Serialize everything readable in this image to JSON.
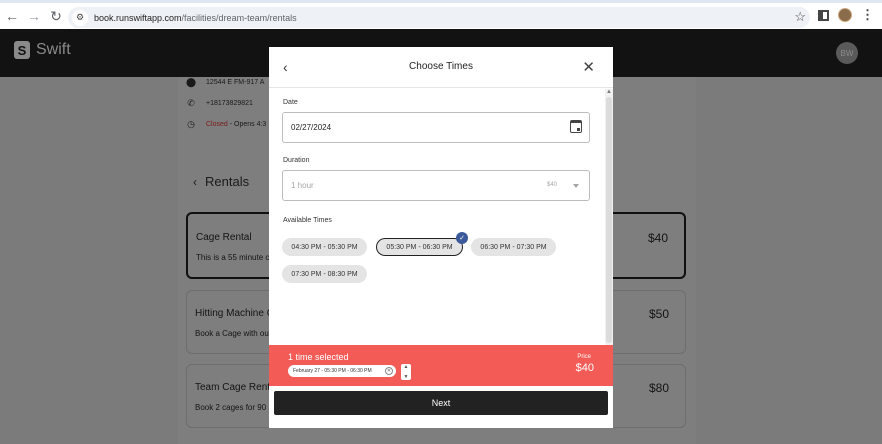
{
  "browser": {
    "url_host": "book.runswiftapp.com",
    "url_path": "/facilities/dream-team/rentals"
  },
  "header": {
    "logo_mark": "S",
    "logo_text": "Swift",
    "avatar_initials": "BW"
  },
  "facility": {
    "address": "12544 E FM-917 A",
    "phone": "+18173829821",
    "status": "Closed",
    "hours": " - Opens 4:3"
  },
  "rentals": {
    "title": "Rentals",
    "cards": [
      {
        "title": "Cage Rental",
        "desc": "This is a 55 minute c",
        "price": "$40"
      },
      {
        "title": "Hitting Machine C",
        "desc": "Book a Cage with ou",
        "price": "$50"
      },
      {
        "title": "Team Cage Rent",
        "desc": "Book 2 cages for 90",
        "price": "$80"
      }
    ]
  },
  "modal": {
    "title": "Choose Times",
    "date_label": "Date",
    "date_value": "02/27/2024",
    "duration_label": "Duration",
    "duration_value": "1 hour",
    "duration_price": "$40",
    "times_label": "Available Times",
    "times": [
      "04:30 PM - 05:30 PM",
      "05:30 PM - 06:30 PM",
      "06:30 PM - 07:30 PM",
      "07:30 PM - 08:30 PM"
    ],
    "selected_count": "1 time selected",
    "selected_chip": "February 27 - 05:30 PM - 06:30 PM",
    "price_label": "Price",
    "price_value": "$40",
    "next_label": "Next"
  },
  "icons": {
    "check": "check-icon",
    "close": "close-icon",
    "back": "chevron-left-icon",
    "calendar": "calendar-icon"
  }
}
